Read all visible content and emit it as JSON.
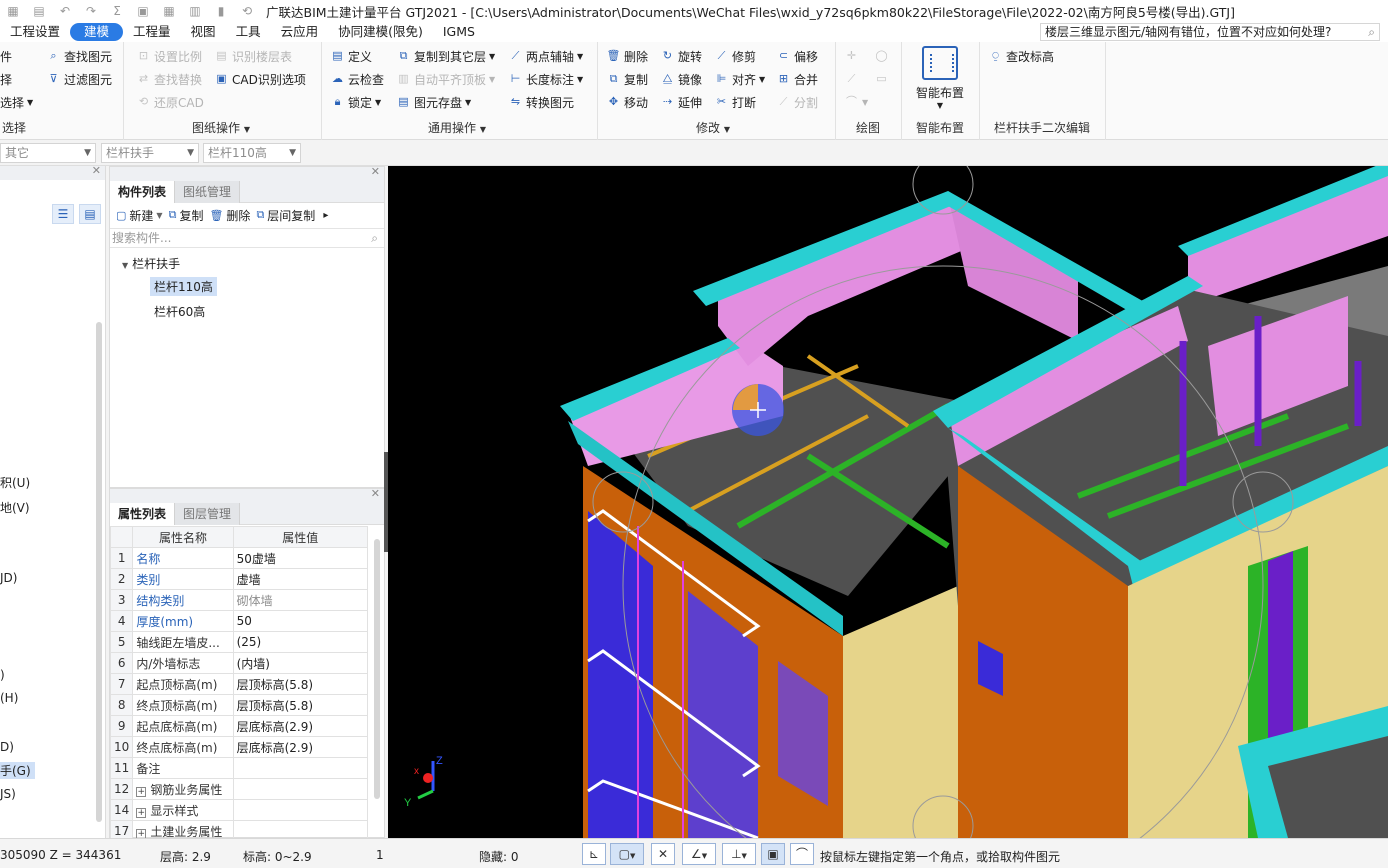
{
  "window": {
    "title": "广联达BIM土建计量平台 GTJ2021 - [C:\\Users\\Administrator\\Documents\\WeChat Files\\wxid_y72sq6pkm80k22\\FileStorage\\File\\2022-02\\南方阿良5号楼(导出).GTJ]"
  },
  "menu": {
    "items": [
      "工程设置",
      "建模",
      "工程量",
      "视图",
      "工具",
      "云应用",
      "协同建模(限免)",
      "IGMS"
    ],
    "active": "建模",
    "help_search": "楼层三维显示图元/轴网有错位，位置不对应如何处理?"
  },
  "ribbon": {
    "select_group": {
      "b1": "件",
      "b2": "择",
      "b3": "选择",
      "b4": "查找图元",
      "b5": "过滤图元",
      "label": "选择"
    },
    "drawing_group": {
      "b1": "设置比例",
      "b2": "识别楼层表",
      "b3": "查找替换",
      "b4": "CAD识别选项",
      "b5": "还原CAD",
      "label": "图纸操作"
    },
    "common_group": {
      "b1": "定义",
      "b2": "复制到其它层",
      "b3": "两点辅轴",
      "b4": "云检查",
      "b5": "自动平齐顶板",
      "b6": "长度标注",
      "b7": "锁定",
      "b8": "图元存盘",
      "b9": "转换图元",
      "label": "通用操作"
    },
    "modify_group": {
      "b1": "删除",
      "b2": "旋转",
      "b3": "修剪",
      "b4": "偏移",
      "b5": "复制",
      "b6": "镜像",
      "b7": "对齐",
      "b8": "合并",
      "b9": "移动",
      "b10": "延伸",
      "b11": "打断",
      "b12": "分割",
      "label": "修改"
    },
    "draw_group": {
      "label": "绘图"
    },
    "smart_group": {
      "button": "智能布置",
      "label": "智能布置"
    },
    "rail_group": {
      "button": "查改标高",
      "label": "栏杆扶手二次编辑"
    }
  },
  "filters": {
    "floor": "其它",
    "type": "栏杆扶手",
    "component": "栏杆110高"
  },
  "left_tree": {
    "items": [
      "积(U)",
      "地(V)",
      "JD)",
      ")",
      "(H)",
      "D)",
      "手(G)",
      "JS)"
    ],
    "selected": "手(G)"
  },
  "component_panel": {
    "tabs": [
      "构件列表",
      "图纸管理"
    ],
    "toolbar": {
      "new": "新建",
      "copy": "复制",
      "delete": "删除",
      "floor_copy": "层间复制"
    },
    "search_placeholder": "搜索构件...",
    "tree": {
      "parent": "栏杆扶手",
      "children": [
        "栏杆110高",
        "栏杆60高"
      ],
      "selected": "栏杆110高"
    }
  },
  "property_panel": {
    "tabs": [
      "属性列表",
      "图层管理"
    ],
    "columns": [
      "属性名称",
      "属性值"
    ],
    "rows": [
      {
        "no": "1",
        "name": "名称",
        "value": "50虚墙",
        "blue": true
      },
      {
        "no": "2",
        "name": "类别",
        "value": "虚墙",
        "blue": true
      },
      {
        "no": "3",
        "name": "结构类别",
        "value": "砌体墙",
        "blue": true,
        "gray": true
      },
      {
        "no": "4",
        "name": "厚度(mm)",
        "value": "50",
        "blue": true
      },
      {
        "no": "5",
        "name": "轴线距左墙皮...",
        "value": "(25)",
        "blue": false
      },
      {
        "no": "6",
        "name": "内/外墙标志",
        "value": "(内墙)",
        "blue": false
      },
      {
        "no": "7",
        "name": "起点顶标高(m)",
        "value": "层顶标高(5.8)",
        "blue": false
      },
      {
        "no": "8",
        "name": "终点顶标高(m)",
        "value": "层顶标高(5.8)",
        "blue": false
      },
      {
        "no": "9",
        "name": "起点底标高(m)",
        "value": "层底标高(2.9)",
        "blue": false
      },
      {
        "no": "10",
        "name": "终点底标高(m)",
        "value": "层底标高(2.9)",
        "blue": false
      },
      {
        "no": "11",
        "name": "备注",
        "value": "",
        "blue": false
      },
      {
        "no": "12",
        "name": "钢筋业务属性",
        "value": "",
        "blue": false,
        "expand": true
      },
      {
        "no": "14",
        "name": "显示样式",
        "value": "",
        "blue": false,
        "expand": true
      },
      {
        "no": "17",
        "name": "土建业务属性",
        "value": "",
        "blue": false,
        "expand": true
      }
    ]
  },
  "status": {
    "coords": "305090 Z = 344361",
    "floor_height": "层高:   2.9",
    "elevation": "标高:   0~2.9",
    "count": "1",
    "hidden": "隐藏:   0",
    "hint": "按鼠标左键指定第一个角点，或拾取构件图元"
  },
  "colors": {
    "accent": "#2a7be4",
    "wall_pink": "#e28ee0",
    "parapet_cyan": "#29cfd2",
    "facade_orange": "#c8600a",
    "facade_cream": "#e6d48a",
    "window_blue": "#3a2bd8",
    "roof_gray": "#505050",
    "beam_green": "#2cb327"
  }
}
